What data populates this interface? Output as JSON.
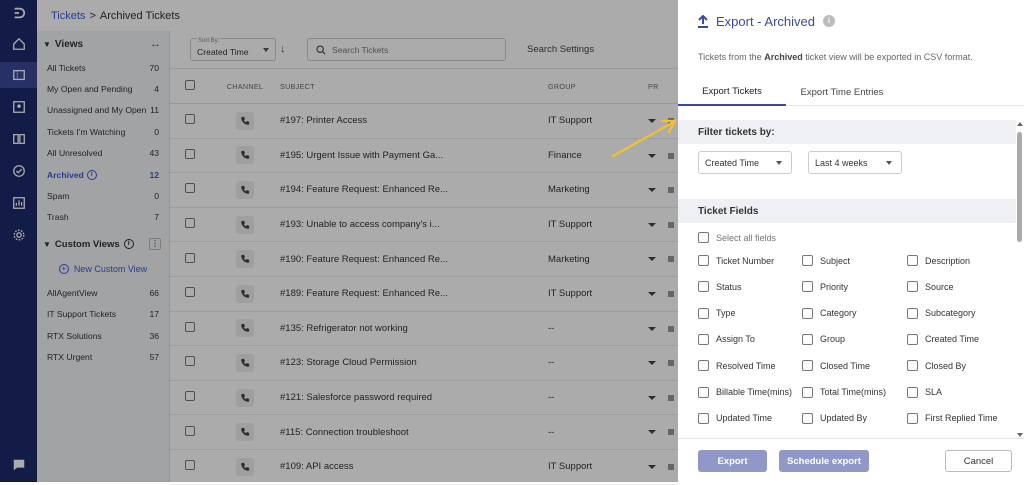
{
  "breadcrumb": {
    "parent": "Tickets",
    "separator": ">",
    "current": "Archived Tickets"
  },
  "views": {
    "title": "Views",
    "items": [
      {
        "label": "All Tickets",
        "count": "70"
      },
      {
        "label": "My Open and Pending",
        "count": "4"
      },
      {
        "label": "Unassigned and My Open",
        "count": "11"
      },
      {
        "label": "Tickets I'm Watching",
        "count": "0"
      },
      {
        "label": "All Unresolved",
        "count": "43"
      },
      {
        "label": "Archived",
        "count": "12",
        "active": true
      },
      {
        "label": "Spam",
        "count": "0"
      },
      {
        "label": "Trash",
        "count": "7"
      }
    ],
    "custom_title": "Custom Views",
    "new_custom_view": "New Custom View",
    "custom_items": [
      {
        "label": "AllAgentView",
        "count": "66"
      },
      {
        "label": "IT Support Tickets",
        "count": "17"
      },
      {
        "label": "RTX Solutions",
        "count": "36"
      },
      {
        "label": "RTX Urgent",
        "count": "57"
      }
    ]
  },
  "toolbar": {
    "sort_label": "Sort By:",
    "sort_value": "Created Time",
    "search_placeholder": "Search Tickets",
    "search_settings": "Search Settings"
  },
  "table": {
    "columns": {
      "channel": "CHANNEL",
      "subject": "SUBJECT",
      "group": "GROUP",
      "priority": "PR"
    },
    "rows": [
      {
        "subject": "#197: Printer Access",
        "group": "IT Support"
      },
      {
        "subject": "#195: Urgent Issue with Payment Ga...",
        "group": "Finance"
      },
      {
        "subject": "#194: Feature Request: Enhanced Re...",
        "group": "Marketing"
      },
      {
        "subject": "#193: Unable to access company's i...",
        "group": "IT Support"
      },
      {
        "subject": "#190: Feature Request: Enhanced Re...",
        "group": "Marketing"
      },
      {
        "subject": "#189: Feature Request: Enhanced Re...",
        "group": "IT Support"
      },
      {
        "subject": "#135: Refrigerator not working",
        "group": "--"
      },
      {
        "subject": "#123: Storage Cloud Permission",
        "group": "--"
      },
      {
        "subject": "#121: Salesforce password required",
        "group": "--"
      },
      {
        "subject": "#115: Connection troubleshoot",
        "group": "--"
      },
      {
        "subject": "#109: API access",
        "group": "IT Support"
      }
    ]
  },
  "export_panel": {
    "title": "Export - Archived",
    "desc_prefix": "Tickets from the",
    "desc_view": "Archived",
    "desc_suffix": "ticket view will be exported in CSV format.",
    "tabs": {
      "tickets": "Export Tickets",
      "time_entries": "Export Time Entries"
    },
    "filter_title": "Filter tickets by:",
    "filter_field": "Created Time",
    "filter_range": "Last 4 weeks",
    "fields_title": "Ticket Fields",
    "select_all": "Select all fields",
    "fields": [
      "Ticket Number",
      "Subject",
      "Description",
      "Status",
      "Priority",
      "Source",
      "Type",
      "Category",
      "Subcategory",
      "Assign To",
      "Group",
      "Created Time",
      "Resolved Time",
      "Closed Time",
      "Closed By",
      "Billable Time(mins)",
      "Total Time(mins)",
      "SLA",
      "Updated Time",
      "Updated By",
      "First Replied Time"
    ],
    "buttons": {
      "export": "Export",
      "schedule": "Schedule export",
      "cancel": "Cancel"
    }
  },
  "colors": {
    "rail": "#1d2a6b",
    "accent": "#3b5bdb",
    "primary_button": "#8f98c8",
    "annotation_arrow": "#f2c12e"
  }
}
